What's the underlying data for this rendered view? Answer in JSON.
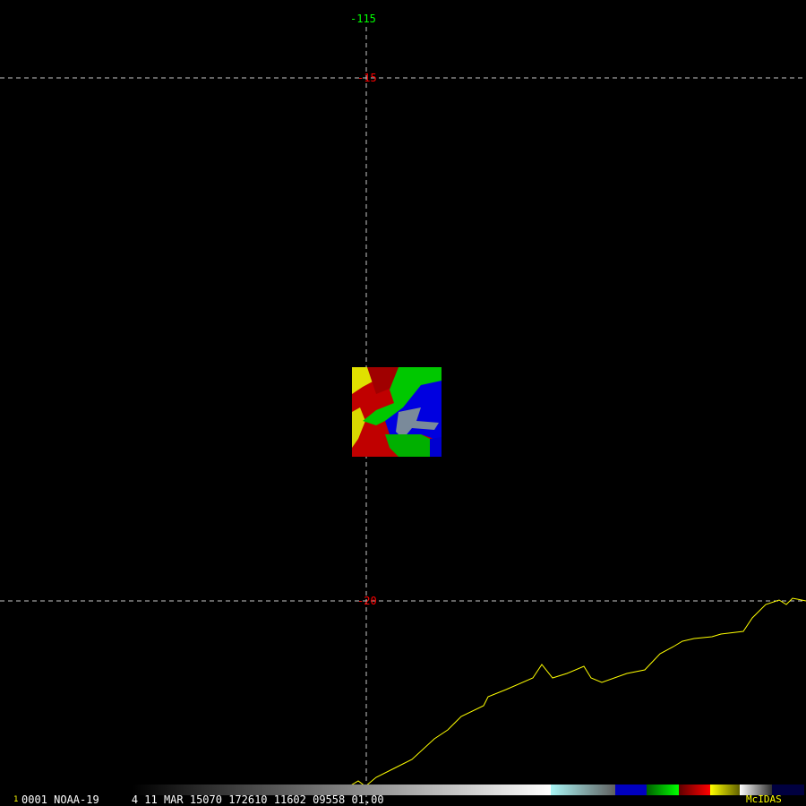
{
  "map": {
    "lon_label": "-115",
    "lat_labels": [
      "-15",
      "-20"
    ],
    "grid_color": "#c8c8c8",
    "coast_color": "#ffff00"
  },
  "status_bar": {
    "frame_number": "1",
    "info": "0001 NOAA-19     4 11 MAR 15070 172610 11602 09558 01.00",
    "brand": "McIDAS"
  },
  "colorbar": {
    "segments": [
      "#000000-#ffffff",
      "#a0f0f0-#707070",
      "#0000c0",
      "#00c000",
      "#c00000",
      "#e0e000",
      "#ffffff-#404040",
      "#000040"
    ]
  }
}
